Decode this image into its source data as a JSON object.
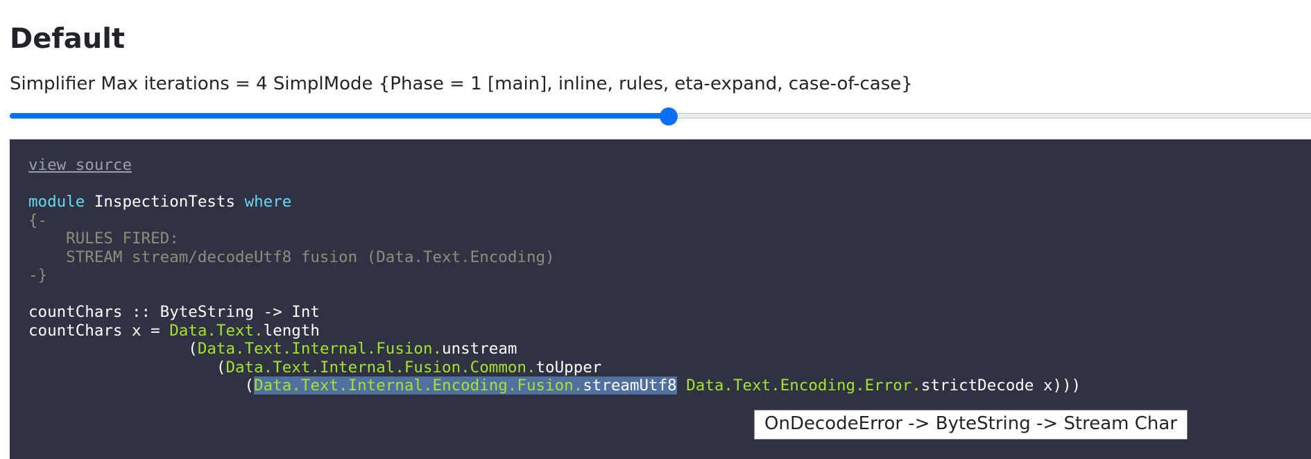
{
  "heading": "Default",
  "simplifier_mode": "Simplifier Max iterations = 4 SimplMode {Phase = 1 [main], inline, rules, eta-expand, case-of-case}",
  "slider": {
    "fraction": 0.5
  },
  "code": {
    "view_source": "view source",
    "module_kw": "module",
    "module_name": " InspectionTests ",
    "where_kw": "where",
    "comment_open": "{-",
    "rules_fired": "    RULES FIRED:",
    "rule_line": "    STREAM stream/decodeUtf8 fusion (Data.Text.Encoding)",
    "comment_close": "-}",
    "sig_line": "countChars :: ByteString -> Int",
    "def_prefix": "countChars x = ",
    "def_qual": "Data.Text.",
    "def_name": "length",
    "l1_indent": "                 (",
    "l1_qual": "Data.Text.Internal.Fusion.",
    "l1_name": "unstream",
    "l2_indent": "                    (",
    "l2_qual": "Data.Text.Internal.Fusion.Common.",
    "l2_name": "toUpper",
    "l3_indent": "                       (",
    "l3_qual": "Data.Text.Internal.Encoding.Fusion.",
    "l3_name": "streamUtf8",
    "l3_qual2": " Data.Text.Encoding.Error.",
    "l3_name2": "strictDecode x)))"
  },
  "tooltip": "OnDecodeError -> ByteString -> Stream Char",
  "colors": {
    "accent": "#0b6ff5",
    "code_bg": "#2f3242",
    "keyword": "#66d9ef",
    "comment": "#8f8c7b",
    "qualifier": "#a6e22e",
    "highlight": "#5070a0"
  }
}
